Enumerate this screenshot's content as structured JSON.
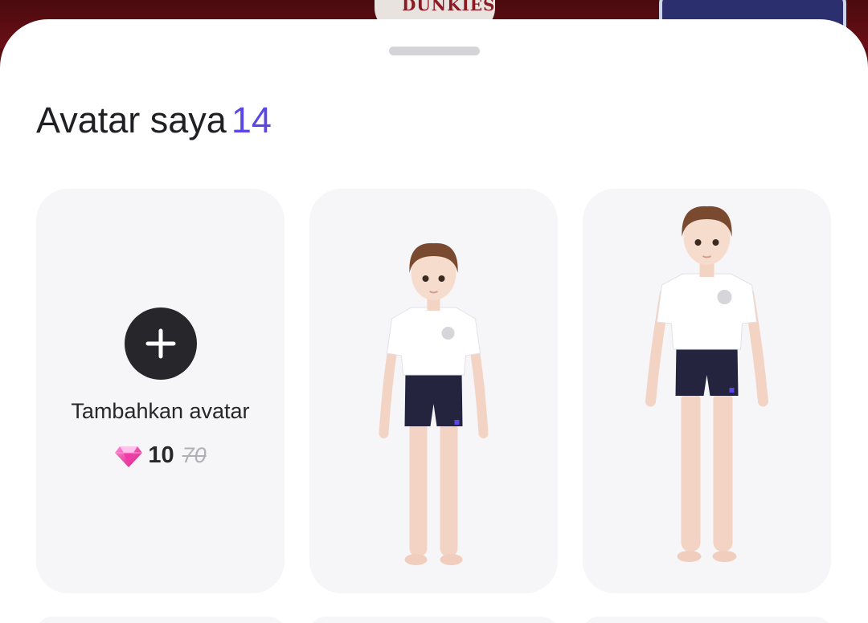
{
  "header": {
    "title": "Avatar saya",
    "count": "14"
  },
  "add_card": {
    "label": "Tambahkan avatar",
    "price_current": "10",
    "price_original": "70",
    "currency_icon": "gem-icon",
    "plus_icon": "plus-icon"
  },
  "avatars": [
    {
      "name": "avatar-1"
    },
    {
      "name": "avatar-2"
    }
  ],
  "backdrop": {
    "shirt_text": "DUNKIES"
  },
  "colors": {
    "accent": "#5b47e6",
    "gem": "#f03aa6",
    "backdrop": "#5a0e12",
    "card_bg": "#f6f6f8"
  }
}
